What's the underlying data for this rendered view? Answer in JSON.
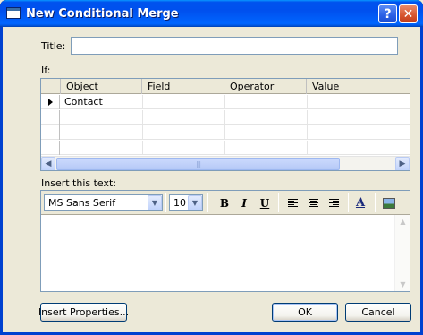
{
  "window": {
    "title": "New Conditional Merge",
    "help_glyph": "?",
    "close_glyph": "✕"
  },
  "form": {
    "title_label": "Title:",
    "title_value": "",
    "if_label": "If:",
    "insert_label": "Insert this text:"
  },
  "grid": {
    "columns": [
      "Object",
      "Field",
      "Operator",
      "Value"
    ],
    "rows": [
      {
        "object": "Contact",
        "field": "",
        "operator": "",
        "value": ""
      }
    ],
    "hscroll_grip": "|||",
    "left_arrow": "◀",
    "right_arrow": "▶"
  },
  "toolbar": {
    "font": "MS Sans Serif",
    "size": "10",
    "bold": "B",
    "italic": "I",
    "underline": "U",
    "color_glyph": "A",
    "dropdown_arrow": "▼"
  },
  "editor": {
    "text": "",
    "up_arrow": "▲",
    "down_arrow": "▼"
  },
  "buttons": {
    "insert_properties": "Insert Properties...",
    "ok": "OK",
    "cancel": "Cancel"
  }
}
